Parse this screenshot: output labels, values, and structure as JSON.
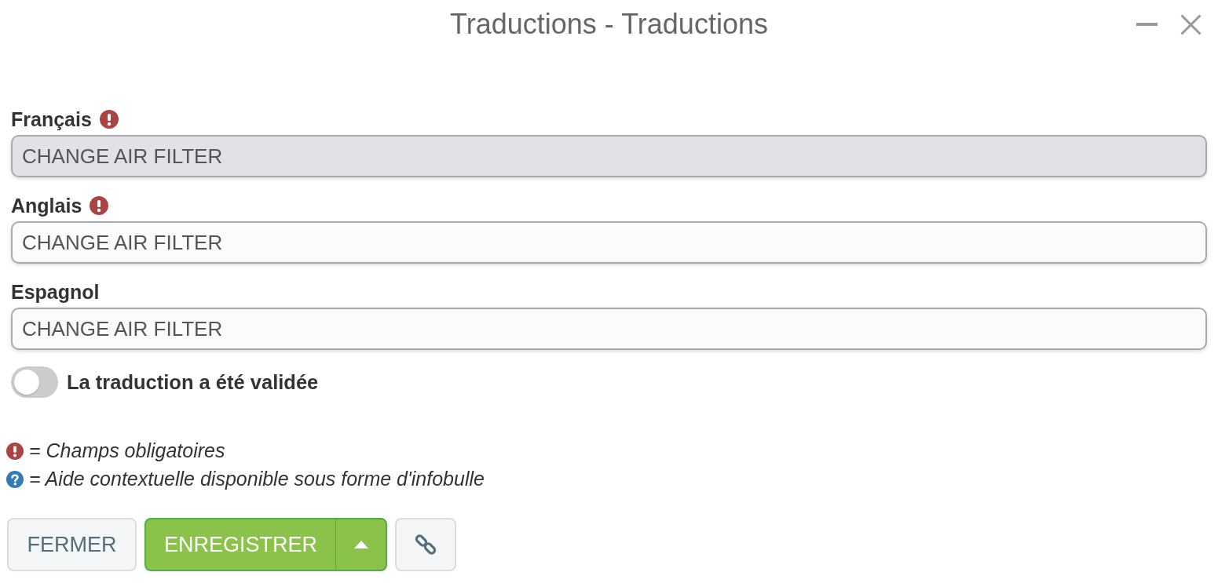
{
  "window": {
    "title": "Traductions - Traductions"
  },
  "fields": [
    {
      "label": "Français",
      "required": true,
      "value": "CHANGE AIR FILTER",
      "disabled": true
    },
    {
      "label": "Anglais",
      "required": true,
      "value": "CHANGE AIR FILTER",
      "disabled": false
    },
    {
      "label": "Espagnol",
      "required": false,
      "value": "CHANGE AIR FILTER",
      "disabled": false
    }
  ],
  "toggle": {
    "label": "La traduction a été validée",
    "on": false
  },
  "legend": [
    {
      "kind": "required",
      "text": "= Champs obligatoires"
    },
    {
      "kind": "help",
      "text": "= Aide contextuelle disponible sous forme d'infobulle"
    }
  ],
  "buttons": [
    {
      "kind": "plain",
      "label": "FERMER"
    },
    {
      "kind": "split",
      "label": "ENREGISTRER"
    },
    {
      "kind": "link"
    }
  ]
}
